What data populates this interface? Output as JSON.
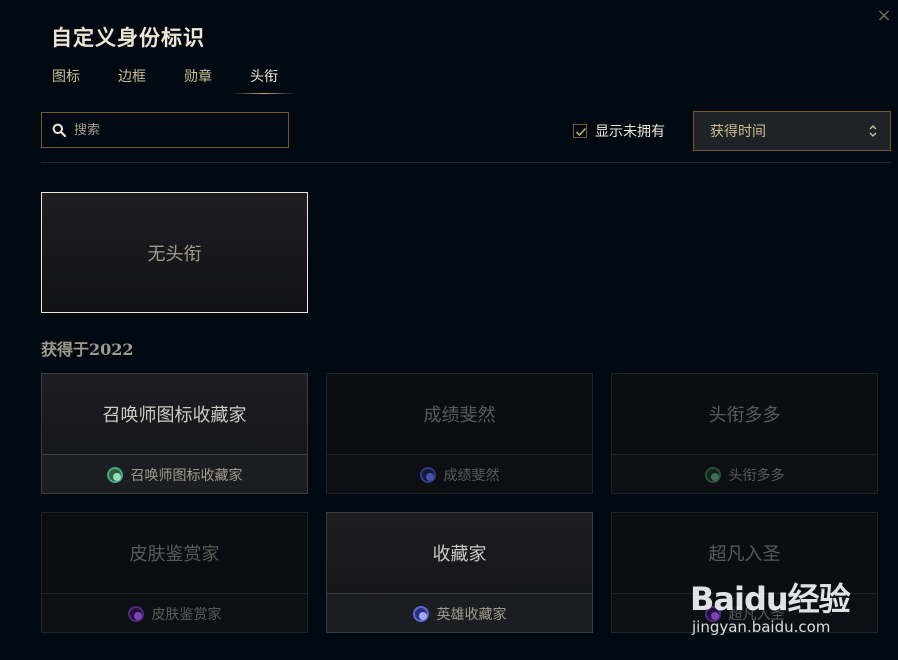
{
  "dialog": {
    "title": "自定义身份标识",
    "close_glyph": "×"
  },
  "tabs": [
    {
      "label": "图标",
      "active": false
    },
    {
      "label": "边框",
      "active": false
    },
    {
      "label": "勋章",
      "active": false
    },
    {
      "label": "头衔",
      "active": true
    }
  ],
  "search": {
    "placeholder": "搜索",
    "value": ""
  },
  "filter": {
    "show_unowned_label": "显示未拥有",
    "show_unowned_checked": true
  },
  "sort": {
    "selected": "获得时间"
  },
  "no_title_option": {
    "label": "无头衔"
  },
  "section": {
    "header": "获得于2022"
  },
  "cards": [
    {
      "title": "召唤师图标收藏家",
      "challenge": "召唤师图标收藏家",
      "owned": true,
      "gem": "green"
    },
    {
      "title": "成绩斐然",
      "challenge": "成绩斐然",
      "owned": false,
      "gem": "blue-dim"
    },
    {
      "title": "头衔多多",
      "challenge": "头衔多多",
      "owned": false,
      "gem": "green dim"
    },
    {
      "title": "皮肤鉴赏家",
      "challenge": "皮肤鉴赏家",
      "owned": false,
      "gem": "purple-dim"
    },
    {
      "title": "收藏家",
      "challenge": "英雄收藏家",
      "owned": true,
      "gem": "blue"
    },
    {
      "title": "超凡入圣",
      "challenge": "超凡入圣",
      "owned": false,
      "gem": "purple-dim"
    }
  ],
  "watermark": {
    "logo": "Baidu经验",
    "url": "jingyan.baidu.com"
  },
  "colors": {
    "background": "#010a13",
    "gold_border": "#785a28",
    "title_text": "#f0e6d2"
  }
}
